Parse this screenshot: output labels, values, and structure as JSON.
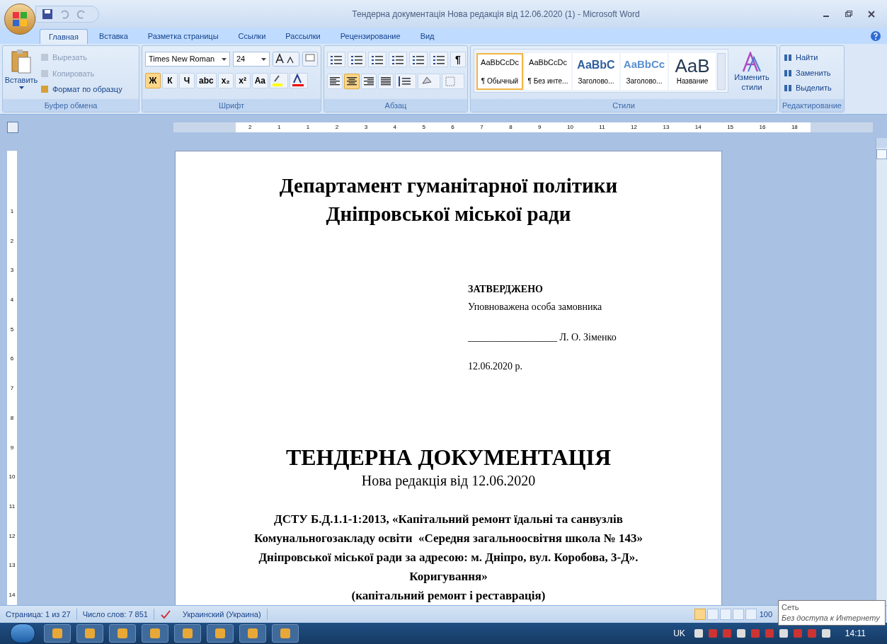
{
  "window": {
    "title": "Тендерна документація Нова редакція від 12.06.2020 (1) - Microsoft Word"
  },
  "tabs": [
    {
      "label": "Главная",
      "selected": true
    },
    {
      "label": "Вставка",
      "selected": false
    },
    {
      "label": "Разметка страницы",
      "selected": false
    },
    {
      "label": "Ссылки",
      "selected": false
    },
    {
      "label": "Рассылки",
      "selected": false
    },
    {
      "label": "Рецензирование",
      "selected": false
    },
    {
      "label": "Вид",
      "selected": false
    }
  ],
  "clipboard": {
    "label": "Буфер обмена",
    "paste": "Вставить",
    "items": [
      {
        "label": "Вырезать",
        "disabled": true
      },
      {
        "label": "Копировать",
        "disabled": true
      },
      {
        "label": "Формат по образцу",
        "disabled": false
      }
    ]
  },
  "font": {
    "label": "Шрифт",
    "name": "Times New Roman",
    "size": "24",
    "buttons": [
      {
        "label": "Ж",
        "selected": true
      },
      {
        "label": "К",
        "selected": false
      },
      {
        "label": "Ч",
        "selected": false
      },
      {
        "label": "abc",
        "selected": false
      },
      {
        "label": "x₂",
        "selected": false
      },
      {
        "label": "x²",
        "selected": false
      },
      {
        "label": "Aa",
        "selected": false
      }
    ]
  },
  "paragraph": {
    "label": "Абзац",
    "pilcrow": "¶",
    "align": [
      {
        "selected": false
      },
      {
        "selected": true
      },
      {
        "selected": false
      },
      {
        "selected": false
      }
    ]
  },
  "styles": {
    "label": "Стили",
    "change": "Изменить стили",
    "items": [
      {
        "sample": "AaBbCcDc",
        "name": "¶ Обычный",
        "kind": "body",
        "selected": true
      },
      {
        "sample": "AaBbCcDc",
        "name": "¶ Без инте...",
        "kind": "body",
        "selected": false
      },
      {
        "sample": "AaBbC",
        "name": "Заголово...",
        "kind": "heading1",
        "selected": false
      },
      {
        "sample": "AaBbCc",
        "name": "Заголово...",
        "kind": "heading2",
        "selected": false
      },
      {
        "sample": "AaB",
        "name": "Название",
        "kind": "title",
        "selected": false
      }
    ]
  },
  "editing": {
    "label": "Редактирование",
    "items": [
      "Найти",
      "Заменить",
      "Выделить"
    ]
  },
  "ruler": {
    "horizontal": [
      "2",
      "1",
      "1",
      "2",
      "3",
      "4",
      "5",
      "6",
      "7",
      "8",
      "9",
      "10",
      "11",
      "12",
      "13",
      "14",
      "15",
      "16",
      "18"
    ],
    "vertical": [
      "1",
      "2",
      "3",
      "4",
      "5",
      "6",
      "7",
      "8",
      "9",
      "10",
      "11",
      "12",
      "13",
      "14"
    ]
  },
  "document": {
    "heading": [
      "Департамент гуманітарної політики",
      "Дніпровської міської ради"
    ],
    "approval": {
      "title": "ЗАТВЕРДЖЕНО",
      "role": "Уповноважена особа замовника",
      "signature": "__________________ Л. О. Зіменко",
      "date": "12.06.2020 р."
    },
    "title": "ТЕНДЕРНА ДОКУМЕНТАЦІЯ",
    "subtitle": "Нова редакція від 12.06.2020",
    "body": [
      "ДСТУ Б.Д.1.1-1:2013, «Капітальний ремонт їдальні та санвузлів",
      "Комунальногозакладу освіти  «Середня загальноосвітня школа № 143»",
      "Дніпровської міської ради за адресою: м. Дніпро, вул. Коробова, 3-Д».",
      "Коригування»",
      "(капітальний ремонт і реставрація)"
    ]
  },
  "status_bar": {
    "page": "Страница: 1 из 27",
    "words": "Число слов: 7 851",
    "language": "Украинский (Украина)",
    "views": [
      {
        "selected": true
      },
      {
        "selected": false
      },
      {
        "selected": false
      },
      {
        "selected": false
      },
      {
        "selected": false
      }
    ],
    "zoom": "100"
  },
  "tooltip": {
    "title": "Сеть",
    "text": "Без доступа к Интернету"
  },
  "taskbar": {
    "language": "UK",
    "clock": "14:11"
  }
}
